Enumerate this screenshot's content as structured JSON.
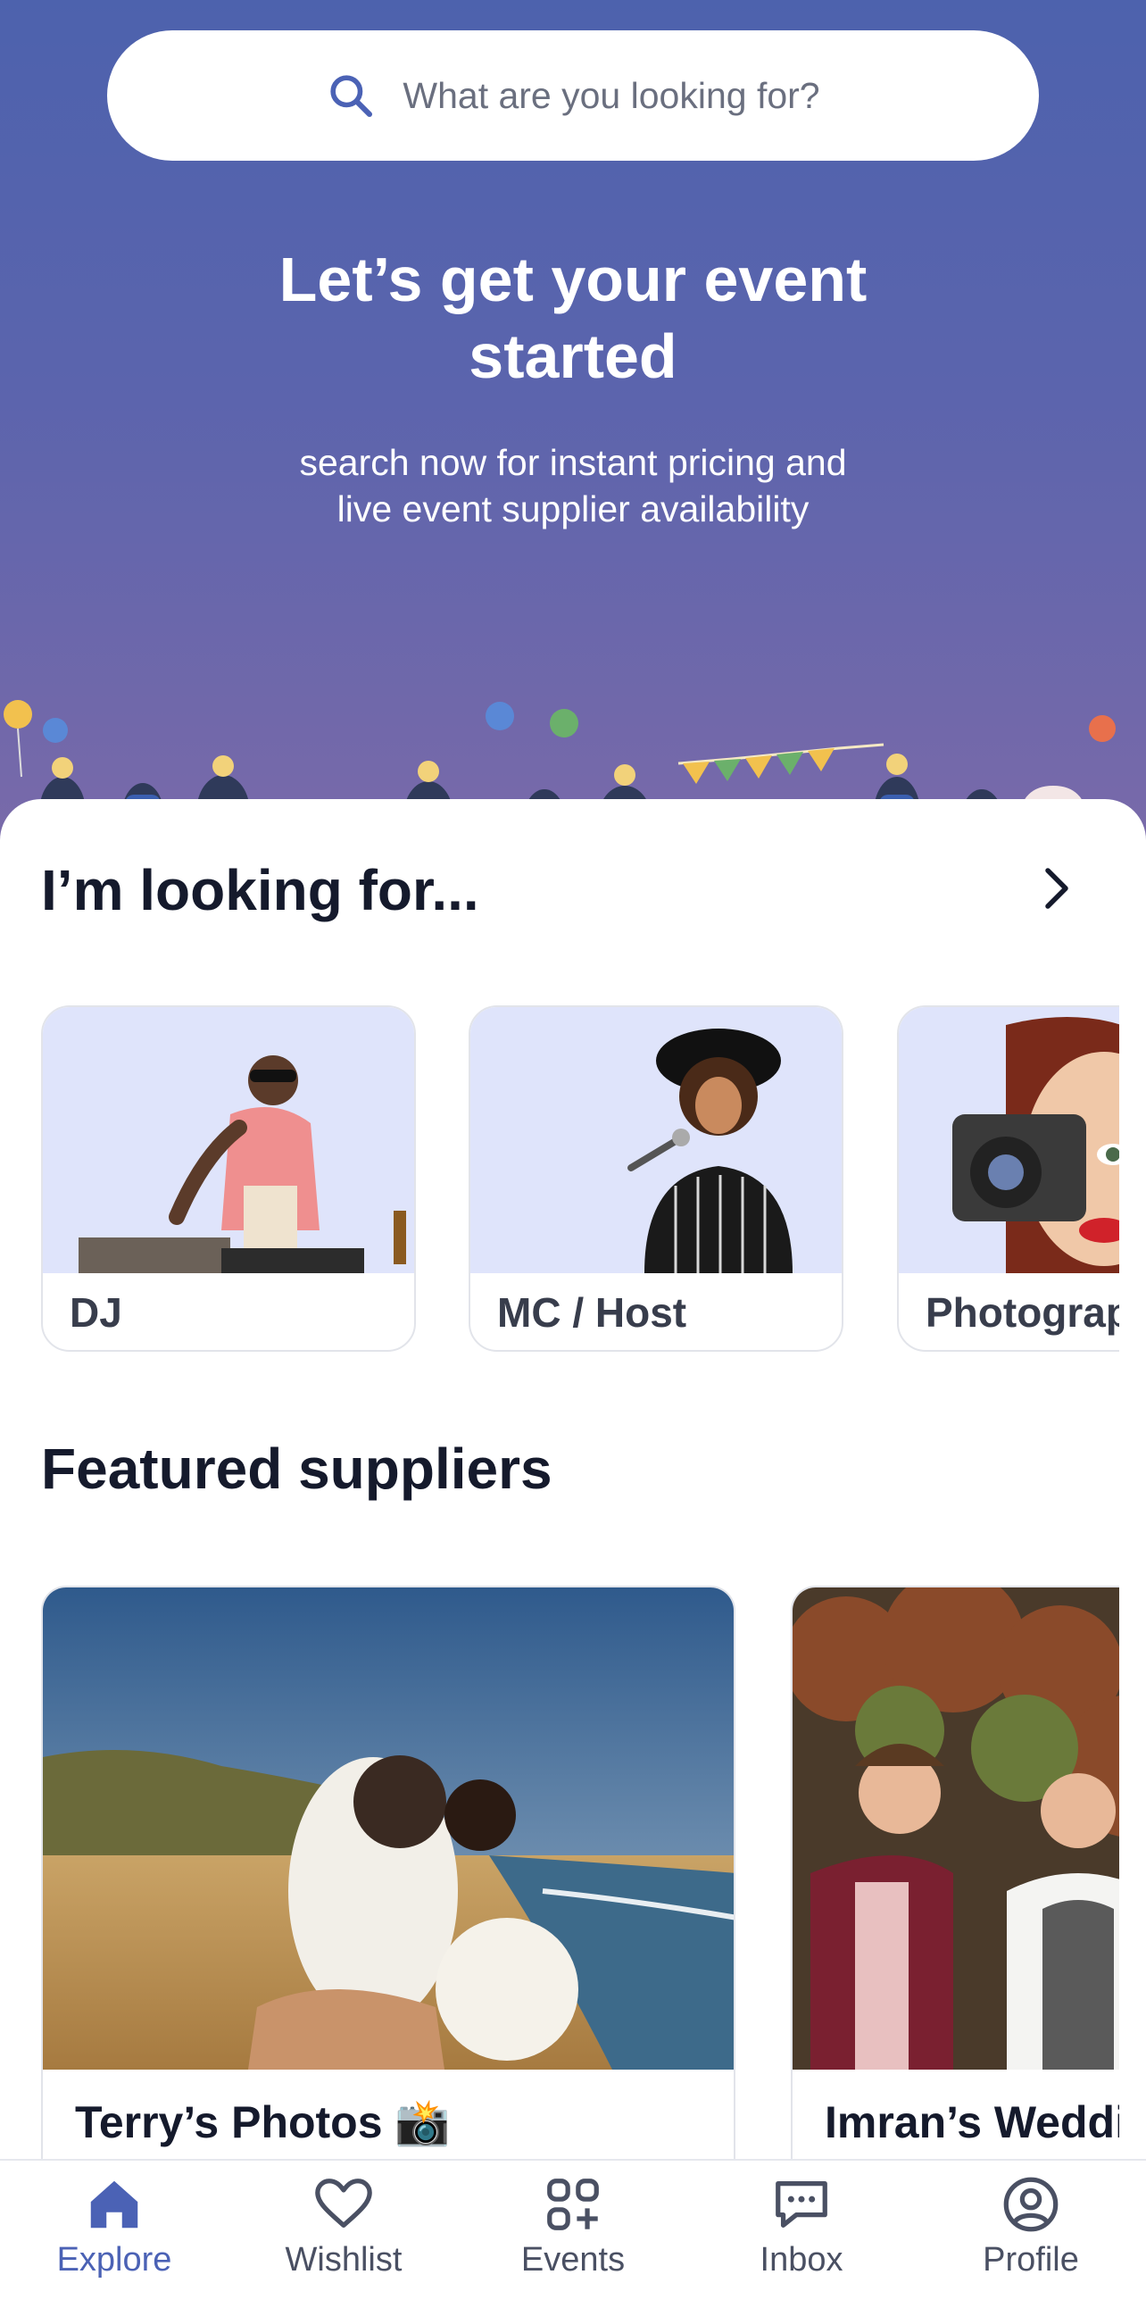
{
  "search": {
    "placeholder": "What are you looking for?"
  },
  "hero": {
    "title_line1": "Let’s get your event",
    "title_line2": "started",
    "subtitle_line1": "search now for instant pricing and",
    "subtitle_line2": "live event supplier availability"
  },
  "categories": {
    "title": "I’m looking for...",
    "items": [
      {
        "label": "DJ",
        "icon": "dj-photo"
      },
      {
        "label": "MC / Host",
        "icon": "mc-host-photo"
      },
      {
        "label": "Photographer",
        "icon": "photographer-photo"
      }
    ]
  },
  "featured": {
    "title": "Featured suppliers",
    "items": [
      {
        "name": "Terry’s Photos 📸"
      },
      {
        "name": "Imran’s Wedding"
      }
    ]
  },
  "tabbar": {
    "items": [
      {
        "label": "Explore",
        "icon": "home-icon",
        "active": true
      },
      {
        "label": "Wishlist",
        "icon": "heart-icon",
        "active": false
      },
      {
        "label": "Events",
        "icon": "grid-plus-icon",
        "active": false
      },
      {
        "label": "Inbox",
        "icon": "chat-icon",
        "active": false
      },
      {
        "label": "Profile",
        "icon": "user-circle-icon",
        "active": false
      }
    ]
  },
  "colors": {
    "brand": "#4b62b5",
    "hero_top": "#4d62ad",
    "hero_bottom": "#7a6aa9",
    "card_bg": "#dfe4fb"
  }
}
